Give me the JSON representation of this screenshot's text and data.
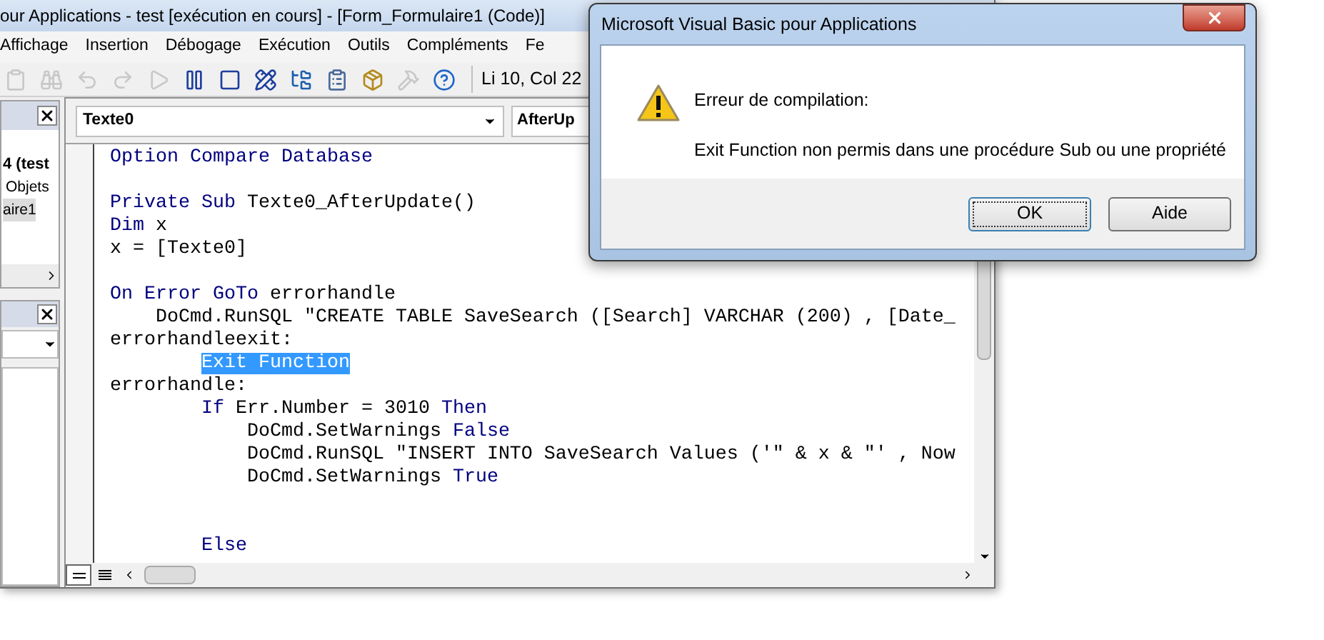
{
  "window": {
    "title": "our Applications - test [exécution en cours] - [Form_Formulaire1 (Code)]"
  },
  "menu": [
    "Affichage",
    "Insertion",
    "Débogage",
    "Exécution",
    "Outils",
    "Compléments",
    "Fe"
  ],
  "toolbar": {
    "buttons": [
      {
        "kind": "paste",
        "disabled": true
      },
      {
        "kind": "find",
        "disabled": true
      },
      {
        "kind": "undo",
        "disabled": true
      },
      {
        "kind": "redo",
        "disabled": true
      },
      {
        "kind": "run",
        "disabled": true
      },
      {
        "kind": "pause",
        "disabled": false
      },
      {
        "kind": "stop",
        "disabled": false
      },
      {
        "kind": "design",
        "disabled": false
      },
      {
        "kind": "explorer",
        "disabled": false
      },
      {
        "kind": "properties",
        "disabled": false
      },
      {
        "kind": "browser",
        "disabled": false
      },
      {
        "kind": "toolbox",
        "disabled": true
      },
      {
        "kind": "help",
        "disabled": false
      }
    ],
    "position": "Li 10, Col 22"
  },
  "project_explorer": {
    "items": [
      {
        "label": "4 (test",
        "selected": false,
        "children": [
          {
            "label": "Objets",
            "selected": false,
            "children": [
              {
                "label": "aire1",
                "selected": true
              }
            ]
          }
        ]
      }
    ]
  },
  "code_window": {
    "object": "Texte0",
    "procedure": "AfterUp",
    "lines": [
      {
        "kind": "code",
        "segments": [
          {
            "kind": "keyword",
            "text": "Option Compare Database"
          }
        ]
      },
      {
        "kind": "blank"
      },
      {
        "kind": "code",
        "segments": [
          {
            "kind": "keyword",
            "text": "Private Sub"
          },
          {
            "kind": "plain",
            "text": " Texte0_AfterUpdate()"
          }
        ]
      },
      {
        "kind": "code",
        "segments": [
          {
            "kind": "keyword",
            "text": "Dim"
          },
          {
            "kind": "plain",
            "text": " x"
          }
        ]
      },
      {
        "kind": "code",
        "segments": [
          {
            "kind": "plain",
            "text": "x = [Texte0]"
          }
        ]
      },
      {
        "kind": "blank"
      },
      {
        "kind": "code",
        "segments": [
          {
            "kind": "keyword",
            "text": "On Error GoTo"
          },
          {
            "kind": "plain",
            "text": " errorhandle"
          }
        ]
      },
      {
        "kind": "code",
        "segments": [
          {
            "kind": "plain",
            "text": "    DoCmd.RunSQL \"CREATE TABLE SaveSearch ([Search] VARCHAR (200) , [Date_"
          }
        ]
      },
      {
        "kind": "code",
        "segments": [
          {
            "kind": "plain",
            "text": "errorhandleexit:"
          }
        ]
      },
      {
        "kind": "code",
        "segments": [
          {
            "kind": "selected",
            "text": "        Exit Function"
          }
        ]
      },
      {
        "kind": "code",
        "segments": [
          {
            "kind": "plain",
            "text": "errorhandle:"
          }
        ]
      },
      {
        "kind": "code",
        "segments": [
          {
            "kind": "keyword",
            "text": "        If"
          },
          {
            "kind": "plain",
            "text": " Err.Number = 3010 "
          },
          {
            "kind": "keyword",
            "text": "Then"
          }
        ]
      },
      {
        "kind": "code",
        "segments": [
          {
            "kind": "plain",
            "text": "            DoCmd.SetWarnings "
          },
          {
            "kind": "keyword",
            "text": "False"
          }
        ]
      },
      {
        "kind": "code",
        "segments": [
          {
            "kind": "plain",
            "text": "            DoCmd.RunSQL \"INSERT INTO SaveSearch Values ('\" & x & \"' , Now"
          }
        ]
      },
      {
        "kind": "code",
        "segments": [
          {
            "kind": "plain",
            "text": "            DoCmd.SetWarnings "
          },
          {
            "kind": "keyword",
            "text": "True"
          }
        ]
      },
      {
        "kind": "blank"
      },
      {
        "kind": "blank"
      },
      {
        "kind": "code",
        "segments": [
          {
            "kind": "keyword",
            "text": "        Else"
          }
        ]
      }
    ]
  },
  "dialog": {
    "title": "Microsoft Visual Basic pour Applications",
    "heading": "Erreur de compilation:",
    "message": "Exit Function non permis dans une procédure Sub ou une propriété",
    "buttons": [
      {
        "label": "OK",
        "selected": true
      },
      {
        "label": "Aide",
        "selected": false
      }
    ]
  }
}
